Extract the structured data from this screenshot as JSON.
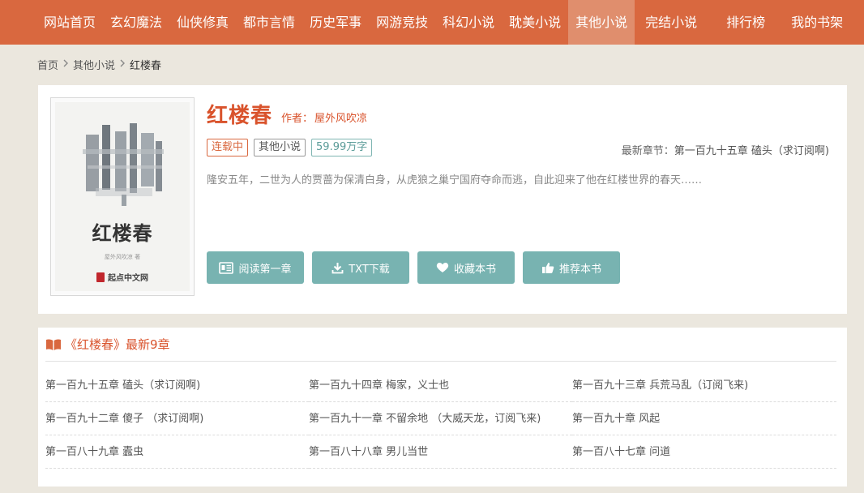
{
  "nav": {
    "items": [
      {
        "label": "网站首页",
        "active": false
      },
      {
        "label": "玄幻魔法",
        "active": false
      },
      {
        "label": "仙侠修真",
        "active": false
      },
      {
        "label": "都市言情",
        "active": false
      },
      {
        "label": "历史军事",
        "active": false
      },
      {
        "label": "网游竞技",
        "active": false
      },
      {
        "label": "科幻小说",
        "active": false
      },
      {
        "label": "耽美小说",
        "active": false
      },
      {
        "label": "其他小说",
        "active": true
      },
      {
        "label": "完结小说",
        "active": false
      },
      {
        "label": "排行榜",
        "active": false
      },
      {
        "label": "我的书架",
        "active": false
      }
    ]
  },
  "breadcrumb": {
    "home": "首页",
    "category": "其他小说",
    "current": "红楼春"
  },
  "book": {
    "title": "红楼春",
    "author_label": "作者：",
    "author": "屋外风吹凉",
    "status_tag": "连载中",
    "category_tag": "其他小说",
    "words_tag": "59.99万字",
    "latest_label": "最新章节：",
    "latest_chapter": "第一百九十五章 磕头（求订阅啊)",
    "intro": "隆安五年，二世为人的贾蔷为保清白身，从虎狼之巢宁国府夺命而逃，自此迎来了他在红楼世界的春天……",
    "cover": {
      "title": "红楼春",
      "author": "屋外风吹凉 著",
      "publisher": "起点中文网"
    },
    "actions": {
      "read": "阅读第一章",
      "txt": "TXT下载",
      "favorite": "收藏本书",
      "recommend": "推荐本书"
    }
  },
  "chapters": {
    "header": "《红楼春》最新9章",
    "items": [
      "第一百九十五章 磕头（求订阅啊)",
      "第一百九十四章 梅家，义士也",
      "第一百九十三章 兵荒马乱（订阅飞来)",
      "第一百九十二章 傻子 （求订阅啊)",
      "第一百九十一章 不留余地 （大威天龙，订阅飞来)",
      "第一百九十章 风起",
      "第一百八十九章 蠹虫",
      "第一百八十八章 男儿当世",
      "第一百八十七章 问道"
    ]
  },
  "colors": {
    "nav_bg": "#d9683f",
    "nav_active": "#e08e6d",
    "accent": "#d9532c",
    "button": "#78b3b1",
    "page_bg": "#ebe7de"
  },
  "icons": {
    "read": "book-open-icon",
    "txt": "download-icon",
    "favorite": "heart-icon",
    "recommend": "thumbs-up-icon",
    "chapters": "open-book-icon",
    "separator": "chevron-right-icon"
  }
}
